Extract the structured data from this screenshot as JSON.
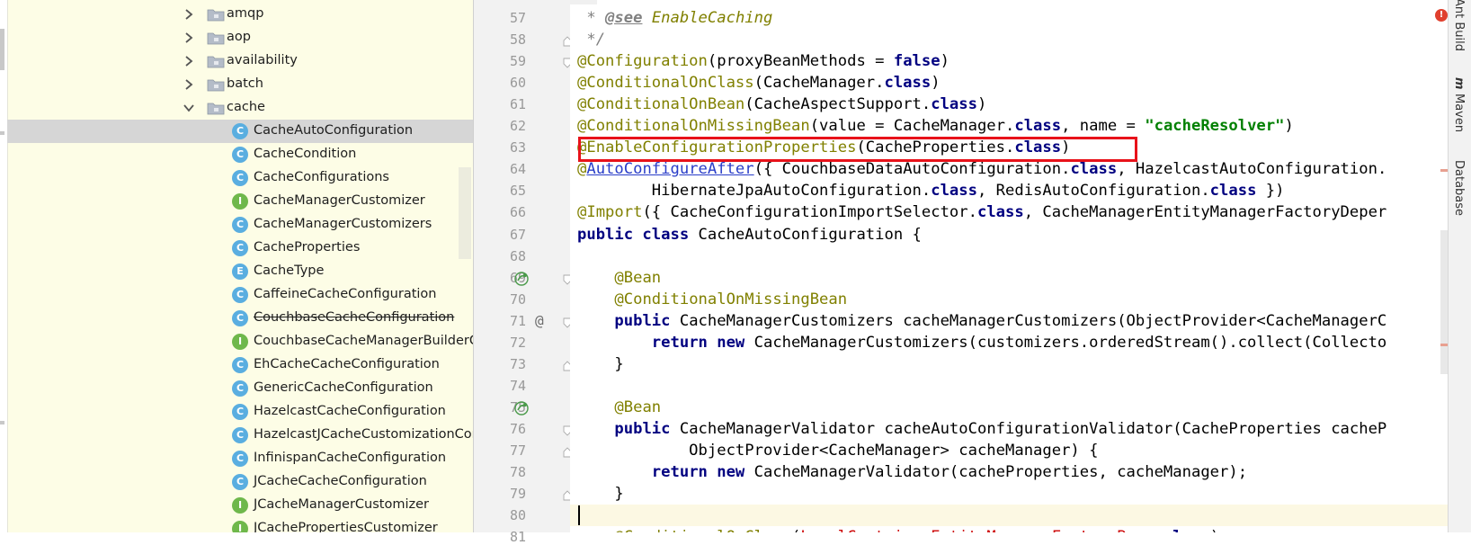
{
  "tree": {
    "items": [
      {
        "label": "amqp",
        "kind": "folder",
        "expanded": false
      },
      {
        "label": "aop",
        "kind": "folder",
        "expanded": false
      },
      {
        "label": "availability",
        "kind": "folder",
        "expanded": false
      },
      {
        "label": "batch",
        "kind": "folder",
        "expanded": false
      },
      {
        "label": "cache",
        "kind": "folder",
        "expanded": true
      },
      {
        "label": "CacheAutoConfiguration",
        "kind": "C",
        "selected": true
      },
      {
        "label": "CacheCondition",
        "kind": "C"
      },
      {
        "label": "CacheConfigurations",
        "kind": "C"
      },
      {
        "label": "CacheManagerCustomizer",
        "kind": "I"
      },
      {
        "label": "CacheManagerCustomizers",
        "kind": "C"
      },
      {
        "label": "CacheProperties",
        "kind": "C"
      },
      {
        "label": "CacheType",
        "kind": "E"
      },
      {
        "label": "CaffeineCacheConfiguration",
        "kind": "C"
      },
      {
        "label": "CouchbaseCacheConfiguration",
        "kind": "C",
        "deprecated": true
      },
      {
        "label": "CouchbaseCacheManagerBuilderC",
        "kind": "I"
      },
      {
        "label": "EhCacheCacheConfiguration",
        "kind": "C"
      },
      {
        "label": "GenericCacheConfiguration",
        "kind": "C"
      },
      {
        "label": "HazelcastCacheConfiguration",
        "kind": "C"
      },
      {
        "label": "HazelcastJCacheCustomizationCon",
        "kind": "C"
      },
      {
        "label": "InfinispanCacheConfiguration",
        "kind": "C"
      },
      {
        "label": "JCacheCacheConfiguration",
        "kind": "C"
      },
      {
        "label": "JCacheManagerCustomizer",
        "kind": "I"
      },
      {
        "label": "JCachePropertiesCustomizer",
        "kind": "I"
      }
    ]
  },
  "editor": {
    "lines": [
      {
        "num": "57",
        "tokens": [
          [
            "cm",
            " * "
          ],
          [
            "cmtag",
            "@see"
          ],
          [
            "cm",
            " "
          ],
          [
            "cmref",
            "EnableCaching"
          ]
        ]
      },
      {
        "num": "58",
        "tokens": [
          [
            "cm",
            " */"
          ]
        ]
      },
      {
        "num": "59",
        "tokens": [
          [
            "an",
            "@Configuration"
          ],
          [
            "",
            "(proxyBeanMethods = "
          ],
          [
            "kw",
            "false"
          ],
          [
            "",
            ")"
          ]
        ]
      },
      {
        "num": "60",
        "tokens": [
          [
            "an",
            "@ConditionalOnClass"
          ],
          [
            "",
            "(CacheManager."
          ],
          [
            "kw",
            "class"
          ],
          [
            "",
            ")"
          ]
        ]
      },
      {
        "num": "61",
        "tokens": [
          [
            "an",
            "@ConditionalOnBean"
          ],
          [
            "",
            "(CacheAspectSupport."
          ],
          [
            "kw",
            "class"
          ],
          [
            "",
            ")"
          ]
        ]
      },
      {
        "num": "62",
        "tokens": [
          [
            "an",
            "@ConditionalOnMissingBean"
          ],
          [
            "",
            "(value = CacheManager."
          ],
          [
            "kw",
            "class"
          ],
          [
            "",
            ", name = "
          ],
          [
            "st",
            "\"cacheResolver\""
          ],
          [
            "",
            ")"
          ]
        ]
      },
      {
        "num": "63",
        "tokens": [
          [
            "an",
            "@EnableConfigurationProperties"
          ],
          [
            "",
            "(CacheProperties."
          ],
          [
            "kw",
            "class"
          ],
          [
            "",
            ")"
          ]
        ]
      },
      {
        "num": "64",
        "tokens": [
          [
            "an",
            "@"
          ],
          [
            "link",
            "AutoConfigureAfter"
          ],
          [
            "",
            "({ CouchbaseDataAutoConfiguration."
          ],
          [
            "kw",
            "class"
          ],
          [
            "",
            ", HazelcastAutoConfiguration."
          ]
        ]
      },
      {
        "num": "65",
        "tokens": [
          [
            "",
            "        HibernateJpaAutoConfiguration."
          ],
          [
            "kw",
            "class"
          ],
          [
            "",
            ", RedisAutoConfiguration."
          ],
          [
            "kw",
            "class"
          ],
          [
            "",
            " })"
          ]
        ]
      },
      {
        "num": "66",
        "tokens": [
          [
            "an",
            "@Import"
          ],
          [
            "",
            "({ CacheConfigurationImportSelector."
          ],
          [
            "kw",
            "class"
          ],
          [
            "",
            ", CacheManagerEntityManagerFactoryDeper"
          ]
        ]
      },
      {
        "num": "67",
        "tokens": [
          [
            "kw",
            "public class"
          ],
          [
            "",
            " CacheAutoConfiguration {"
          ]
        ]
      },
      {
        "num": "68",
        "tokens": []
      },
      {
        "num": "69",
        "tokens": [
          [
            "",
            "    "
          ],
          [
            "an",
            "@Bean"
          ]
        ]
      },
      {
        "num": "70",
        "tokens": [
          [
            "",
            "    "
          ],
          [
            "an",
            "@ConditionalOnMissingBean"
          ]
        ]
      },
      {
        "num": "71",
        "tokens": [
          [
            "",
            "    "
          ],
          [
            "kw",
            "public"
          ],
          [
            "",
            " CacheManagerCustomizers cacheManagerCustomizers(ObjectProvider<CacheManagerC"
          ]
        ]
      },
      {
        "num": "72",
        "tokens": [
          [
            "",
            "        "
          ],
          [
            "kw",
            "return new"
          ],
          [
            "",
            " CacheManagerCustomizers(customizers.orderedStream().collect(Collecto"
          ]
        ]
      },
      {
        "num": "73",
        "tokens": [
          [
            "",
            "    }"
          ]
        ]
      },
      {
        "num": "74",
        "tokens": []
      },
      {
        "num": "75",
        "tokens": [
          [
            "",
            "    "
          ],
          [
            "an",
            "@Bean"
          ]
        ]
      },
      {
        "num": "76",
        "tokens": [
          [
            "",
            "    "
          ],
          [
            "kw",
            "public"
          ],
          [
            "",
            " CacheManagerValidator cacheAutoConfigurationValidator(CacheProperties cacheP"
          ]
        ]
      },
      {
        "num": "77",
        "tokens": [
          [
            "",
            "            ObjectProvider<CacheManager> cacheManager) {"
          ]
        ]
      },
      {
        "num": "78",
        "tokens": [
          [
            "",
            "        "
          ],
          [
            "kw",
            "return new"
          ],
          [
            "",
            " CacheManagerValidator(cacheProperties, cacheManager);"
          ]
        ]
      },
      {
        "num": "79",
        "tokens": [
          [
            "",
            "    }"
          ]
        ]
      },
      {
        "num": "80",
        "tokens": []
      },
      {
        "num": "81",
        "tokens": [
          [
            "",
            "    "
          ],
          [
            "an",
            "@ConditionalOnClass"
          ],
          [
            "",
            "("
          ],
          [
            "red",
            "LocalContainerEntityManagerFactoryBean"
          ],
          [
            "",
            "."
          ],
          [
            "kw",
            "class"
          ],
          [
            "",
            ")"
          ]
        ]
      }
    ]
  },
  "right_panel": {
    "tabs": [
      "Ant Build",
      "m",
      "Maven",
      "Database"
    ]
  },
  "error_indicator": "!"
}
